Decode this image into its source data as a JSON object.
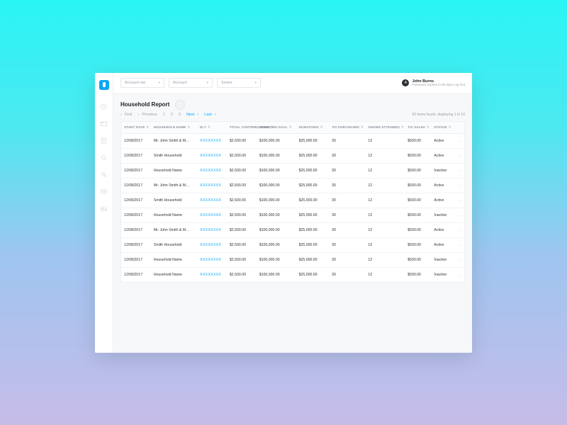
{
  "topbar": {
    "selects": [
      {
        "label": "Account rep"
      },
      {
        "label": "Account"
      },
      {
        "label": "Series"
      }
    ],
    "user": {
      "initial": "A",
      "name": "John Burns",
      "subtext": "Password expires in 98 days Log Out"
    }
  },
  "page": {
    "title": "Household Report",
    "result_text": "83 items found, displaying 1 to 10"
  },
  "pagination": {
    "first": "First",
    "prev": "Previous",
    "pages": [
      "1",
      "2",
      "3"
    ],
    "next": "Next",
    "last": "Last"
  },
  "columns": [
    "START DATE",
    "HOUSEHOLD NAME",
    "ID #",
    "TOTAL CONTRIBUTIONS",
    "DONATION GOAL",
    "DONATIONS",
    "TIX PURCHASED",
    "SHOWS ATTENDED",
    "TIX SALES",
    "STATUS",
    ""
  ],
  "rows": [
    {
      "date": "12/08/2017",
      "name": "Mr. John Smith & M…",
      "id": "XXXXXXXX",
      "contrib": "$2,500.00",
      "goal": "$100,000.00",
      "donations": "$25,000.00",
      "tix": "30",
      "shows": "12",
      "sales": "$500.00",
      "status": "Active"
    },
    {
      "date": "12/08/2017",
      "name": "Smith Household",
      "id": "XXXXXXXX",
      "contrib": "$2,500.00",
      "goal": "$100,000.00",
      "donations": "$25,000.00",
      "tix": "30",
      "shows": "12",
      "sales": "$500.00",
      "status": "Active"
    },
    {
      "date": "12/08/2017",
      "name": "Household Name",
      "id": "XXXXXXXX",
      "contrib": "$2,500.00",
      "goal": "$100,000.00",
      "donations": "$25,000.00",
      "tix": "30",
      "shows": "12",
      "sales": "$500.00",
      "status": "Inactive"
    },
    {
      "date": "12/08/2017",
      "name": "Mr. John Smith & M…",
      "id": "XXXXXXXX",
      "contrib": "$2,500.00",
      "goal": "$100,000.00",
      "donations": "$25,000.00",
      "tix": "30",
      "shows": "12",
      "sales": "$500.00",
      "status": "Active"
    },
    {
      "date": "12/08/2017",
      "name": "Smith Household",
      "id": "XXXXXXXX",
      "contrib": "$2,500.00",
      "goal": "$100,000.00",
      "donations": "$25,000.00",
      "tix": "30",
      "shows": "12",
      "sales": "$500.00",
      "status": "Active"
    },
    {
      "date": "12/08/2017",
      "name": "Household Name",
      "id": "XXXXXXXX",
      "contrib": "$2,500.00",
      "goal": "$100,000.00",
      "donations": "$25,000.00",
      "tix": "30",
      "shows": "12",
      "sales": "$500.00",
      "status": "Inactive"
    },
    {
      "date": "12/08/2017",
      "name": "Mr. John Smith & M…",
      "id": "XXXXXXXX",
      "contrib": "$2,500.00",
      "goal": "$100,000.00",
      "donations": "$25,000.00",
      "tix": "30",
      "shows": "12",
      "sales": "$500.00",
      "status": "Active"
    },
    {
      "date": "12/08/2017",
      "name": "Smith Household",
      "id": "XXXXXXXX",
      "contrib": "$2,500.00",
      "goal": "$100,000.00",
      "donations": "$25,000.00",
      "tix": "30",
      "shows": "12",
      "sales": "$500.00",
      "status": "Active"
    },
    {
      "date": "12/08/2017",
      "name": "Household Name",
      "id": "XXXXXXXX",
      "contrib": "$2,500.00",
      "goal": "$100,000.00",
      "donations": "$25,000.00",
      "tix": "30",
      "shows": "12",
      "sales": "$500.00",
      "status": "Inactive"
    },
    {
      "date": "12/08/2017",
      "name": "Household Name",
      "id": "XXXXXXXX",
      "contrib": "$2,500.00",
      "goal": "$100,000.00",
      "donations": "$25,000.00",
      "tix": "30",
      "shows": "12",
      "sales": "$500.00",
      "status": "Inactive"
    }
  ]
}
